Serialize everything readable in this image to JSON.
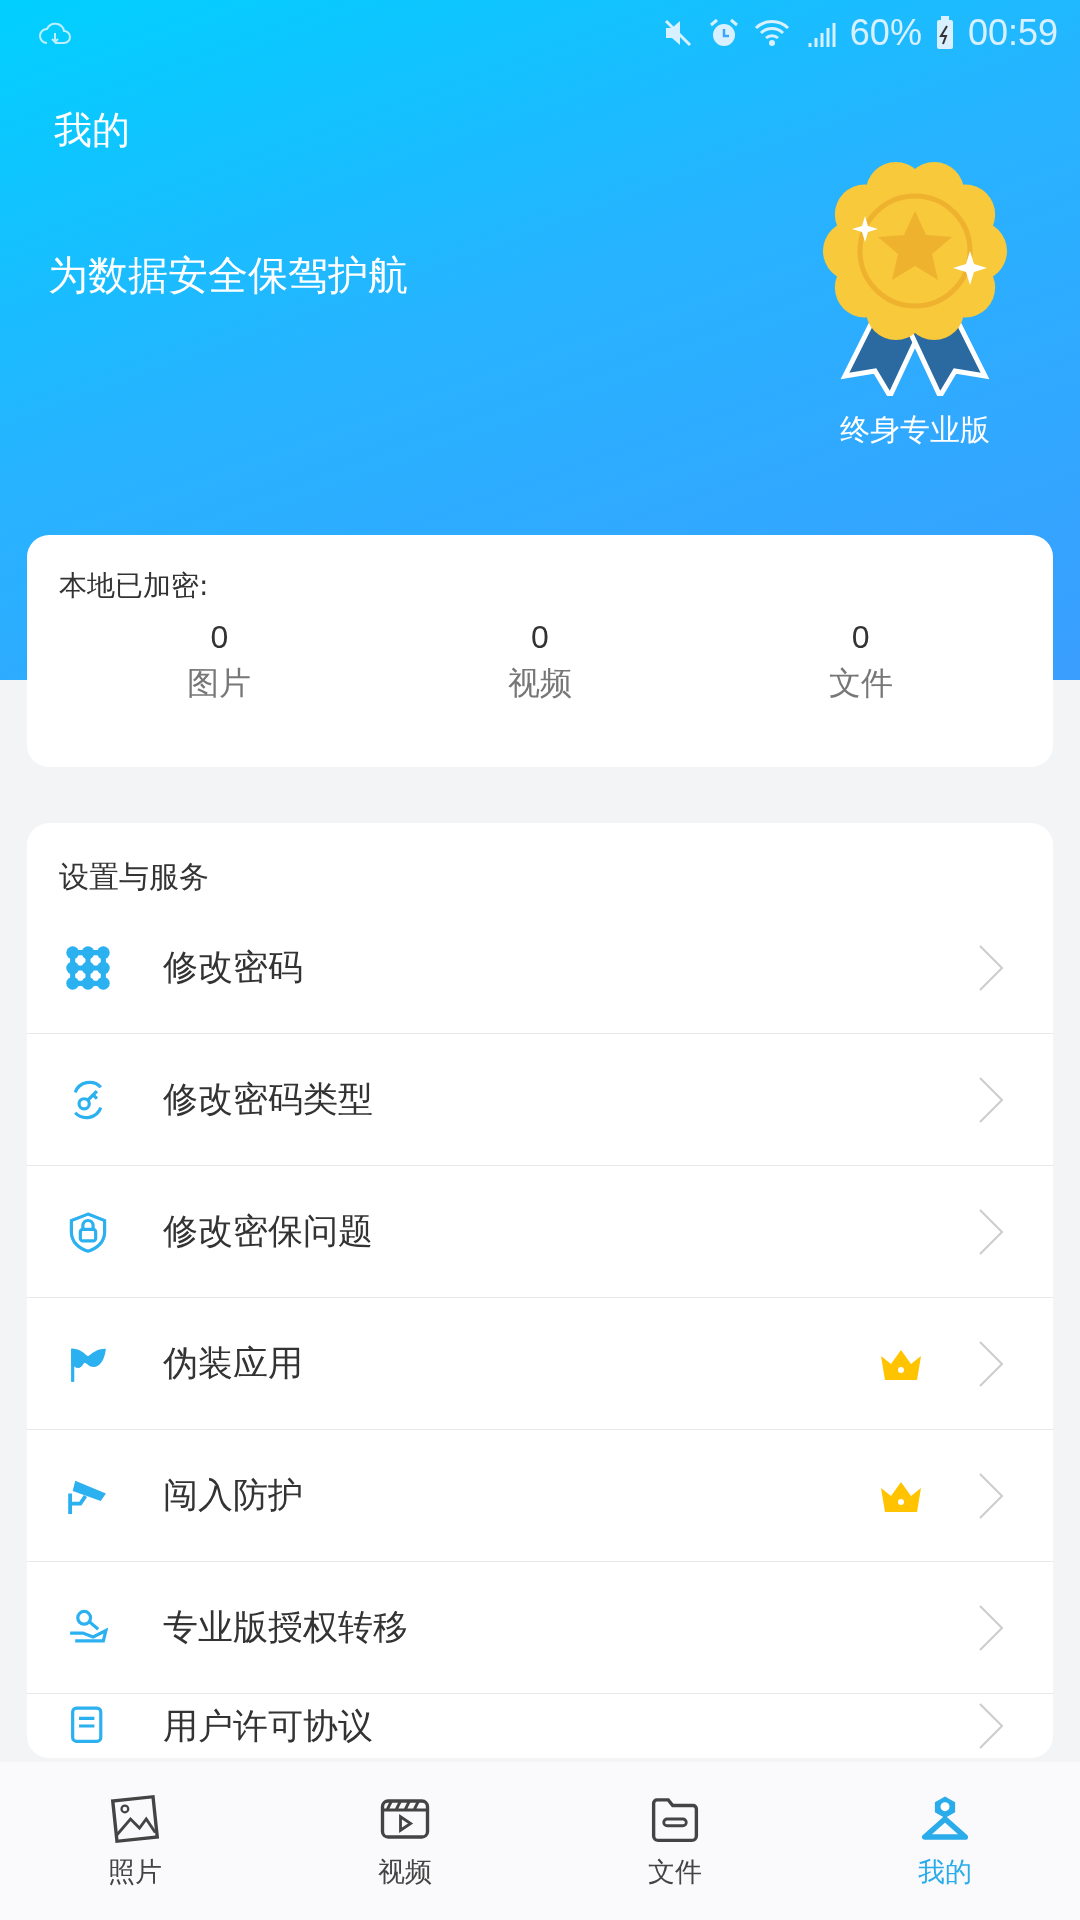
{
  "status_bar": {
    "battery": "60%",
    "time": "00:59"
  },
  "header": {
    "title": "我的",
    "tagline": "为数据安全保驾护航",
    "badge_label": "终身专业版"
  },
  "stats": {
    "title": "本地已加密:",
    "items": [
      {
        "count": "0",
        "label": "图片"
      },
      {
        "count": "0",
        "label": "视频"
      },
      {
        "count": "0",
        "label": "文件"
      }
    ]
  },
  "settings": {
    "title": "设置与服务",
    "items": [
      {
        "label": "修改密码",
        "vip": false
      },
      {
        "label": "修改密码类型",
        "vip": false
      },
      {
        "label": "修改密保问题",
        "vip": false
      },
      {
        "label": "伪装应用",
        "vip": true
      },
      {
        "label": "闯入防护",
        "vip": true
      },
      {
        "label": "专业版授权转移",
        "vip": false
      },
      {
        "label": "用户许可协议",
        "vip": false
      }
    ]
  },
  "bottom_nav": [
    {
      "label": "照片",
      "selected": false
    },
    {
      "label": "视频",
      "selected": false
    },
    {
      "label": "文件",
      "selected": false
    },
    {
      "label": "我的",
      "selected": true
    }
  ]
}
